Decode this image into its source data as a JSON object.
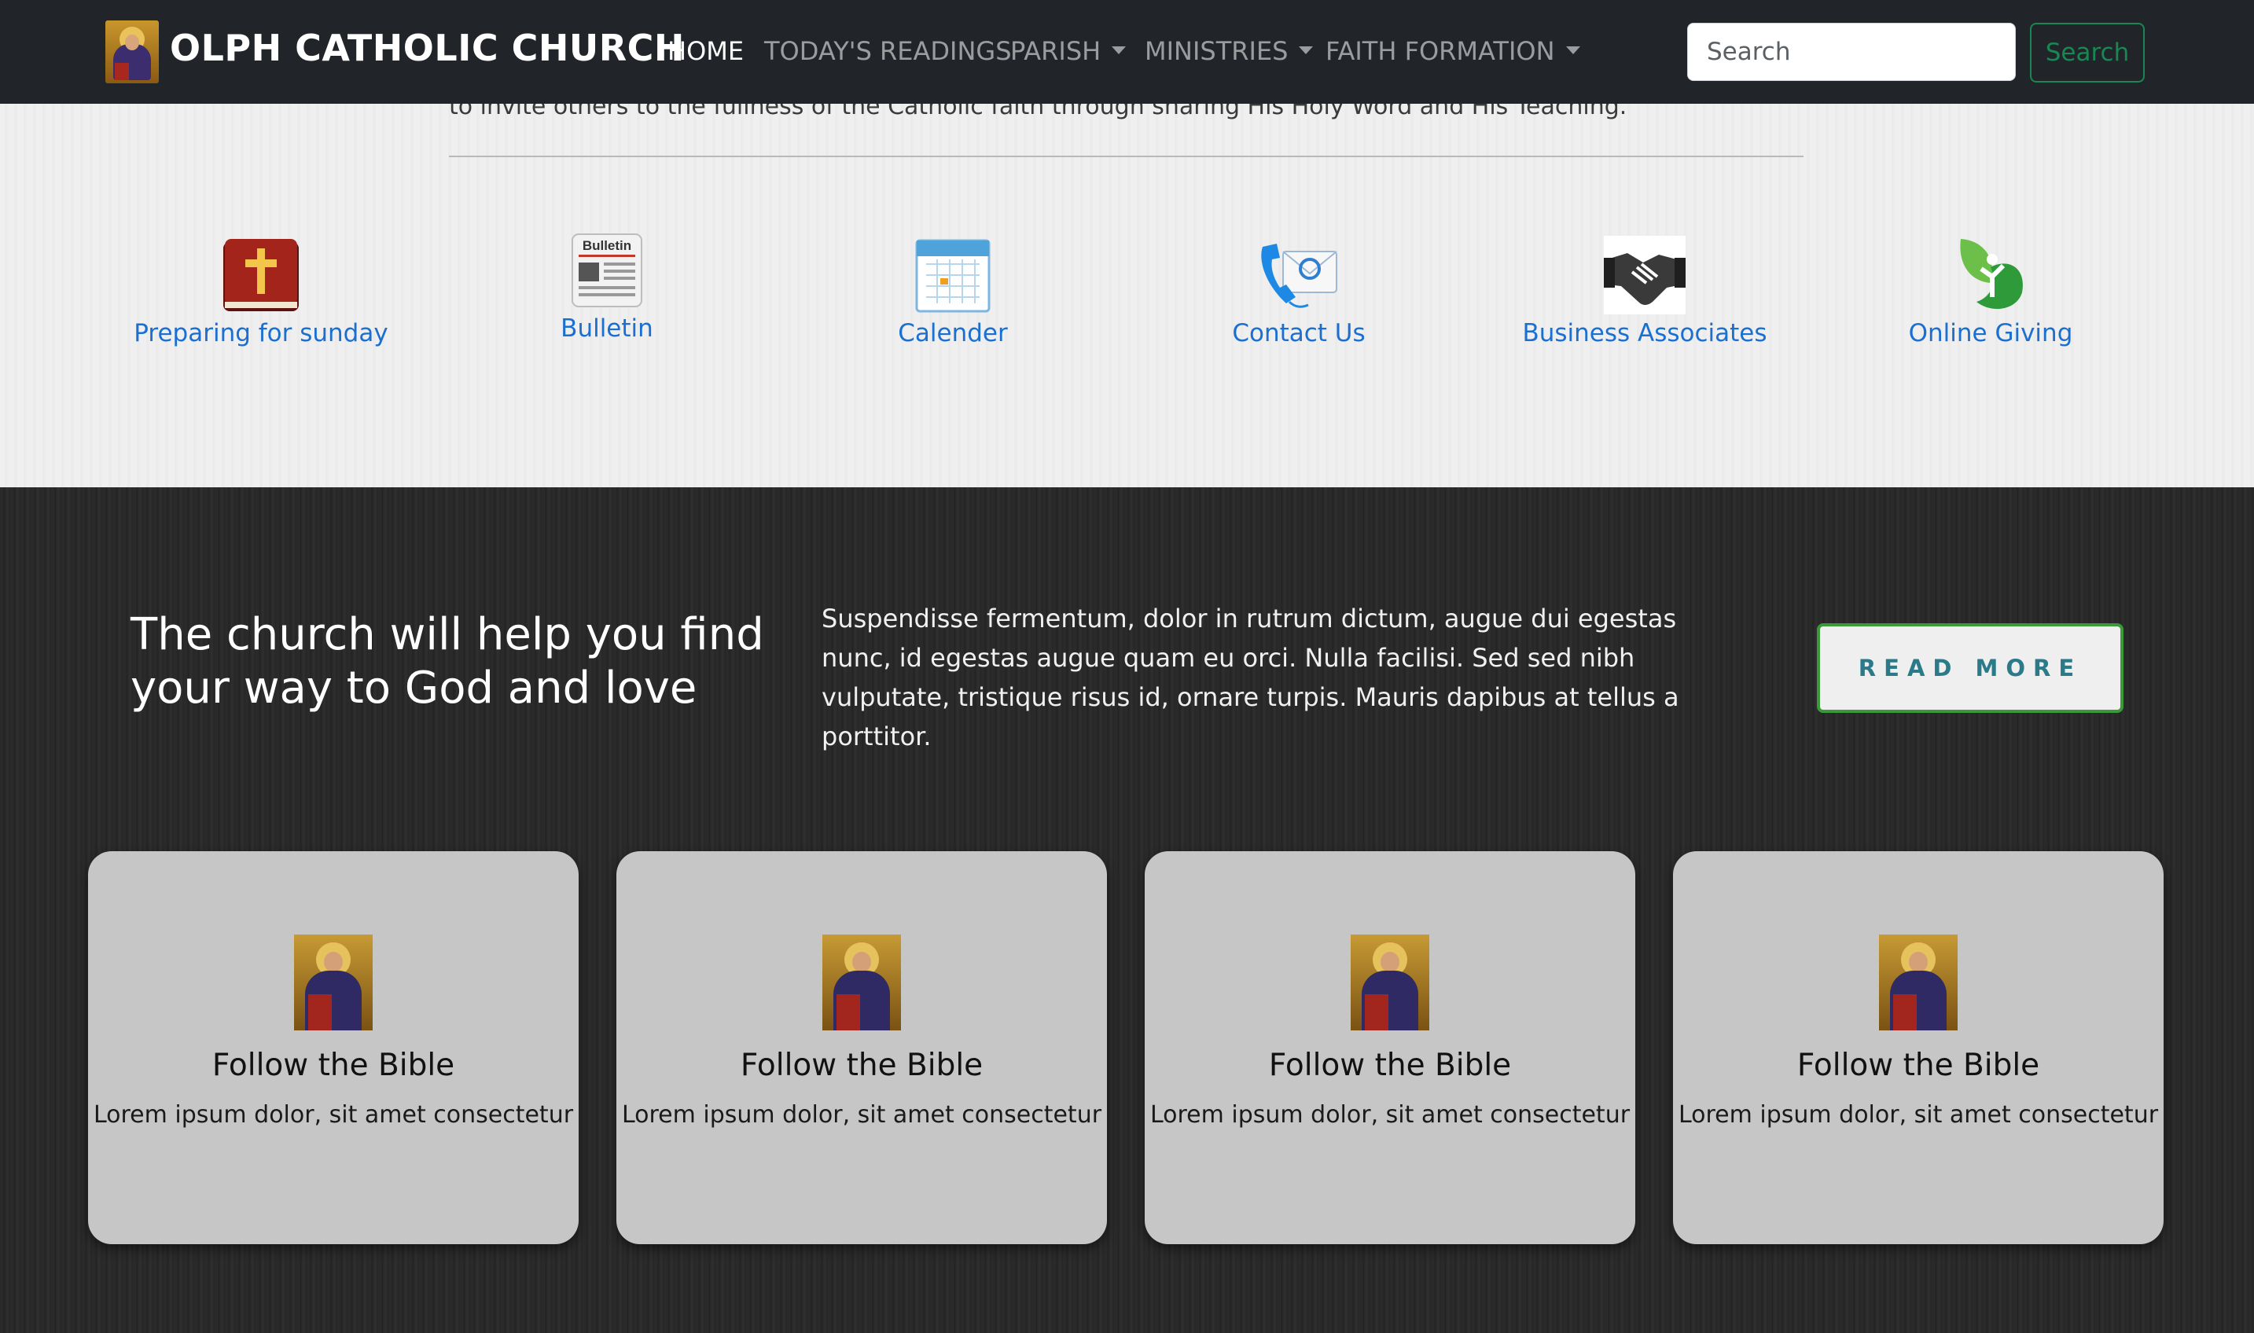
{
  "navbar": {
    "brand": "OLPH CATHOLIC CHURCH",
    "links": [
      {
        "label": "HOME"
      },
      {
        "label": "TODAY'S READINGS"
      },
      {
        "label": "PARISH"
      },
      {
        "label": "MINISTRIES"
      },
      {
        "label": "FAITH FORMATION"
      }
    ],
    "search_placeholder": "Search",
    "search_button": "Search"
  },
  "intro": {
    "text": "to invite others to the fullness of the Catholic faith through sharing His Holy Word and His Teaching."
  },
  "quick_links": [
    {
      "label": "Preparing for sunday",
      "icon": "bible-icon"
    },
    {
      "label": "Bulletin",
      "icon": "bulletin-icon"
    },
    {
      "label": "Calender",
      "icon": "calendar-icon"
    },
    {
      "label": "Contact Us",
      "icon": "contact-icon"
    },
    {
      "label": "Business Associates",
      "icon": "handshake-icon"
    },
    {
      "label": "Online Giving",
      "icon": "giving-icon"
    }
  ],
  "icon_text": {
    "bulletin": "Bulletin"
  },
  "hero": {
    "title": "The church will help you find your way to God and love",
    "text": "Suspendisse fermentum, dolor in rutrum dictum, augue dui egestas nunc, id egestas augue quam eu orci. Nulla facilisi. Sed sed nibh vulputate, tristique risus id, ornare turpis. Mauris dapibus at tellus a porttitor.",
    "button": "READ MORE"
  },
  "cards": [
    {
      "title": "Follow the Bible",
      "text": "Lorem ipsum dolor, sit amet consectetur"
    },
    {
      "title": "Follow the Bible",
      "text": "Lorem ipsum dolor, sit amet consectetur"
    },
    {
      "title": "Follow the Bible",
      "text": "Lorem ipsum dolor, sit amet consectetur"
    },
    {
      "title": "Follow the Bible",
      "text": "Lorem ipsum dolor, sit amet consectetur"
    }
  ],
  "colors": {
    "navbar_bg": "#212529",
    "link_blue": "#1a6fd1",
    "accent_green": "#198754",
    "card_bg": "#c6c6c6"
  }
}
